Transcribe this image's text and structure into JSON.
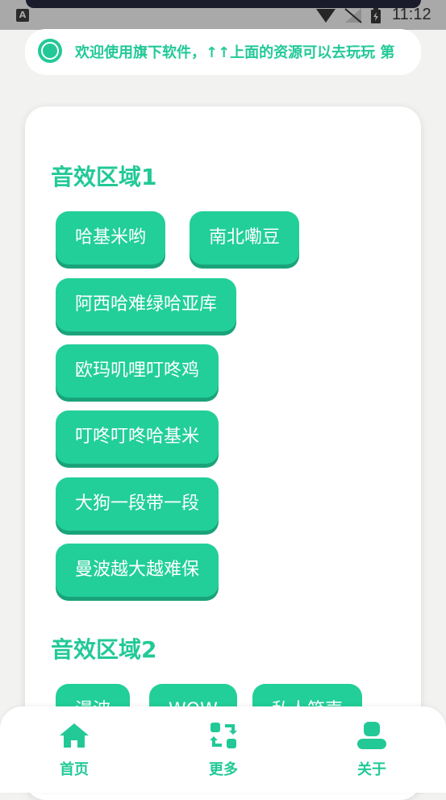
{
  "status_bar": {
    "time": "11:12",
    "app_indicator": "A"
  },
  "marquee": {
    "text": "欢迎使用旗下软件，↑↑上面的资源可以去玩玩 第"
  },
  "sections": [
    {
      "title": "音效区域1",
      "buttons": [
        "哈基米哟",
        "南北嘞豆",
        "阿西哈难绿哈亚库",
        "欧玛叽哩叮咚鸡",
        "叮咚叮咚哈基米",
        "大狗一段带一段",
        "曼波越大越难保"
      ]
    },
    {
      "title": "音效区域2",
      "buttons": [
        "漫波",
        "WOW",
        "私人笑声"
      ]
    }
  ],
  "nav": [
    {
      "label": "首页",
      "icon": "home-icon"
    },
    {
      "label": "更多",
      "icon": "swap-icon"
    },
    {
      "label": "关于",
      "icon": "user-icon"
    }
  ],
  "colors": {
    "accent": "#22c997",
    "chip": "#22cf98",
    "chip_shadow": "#1aa37a"
  }
}
